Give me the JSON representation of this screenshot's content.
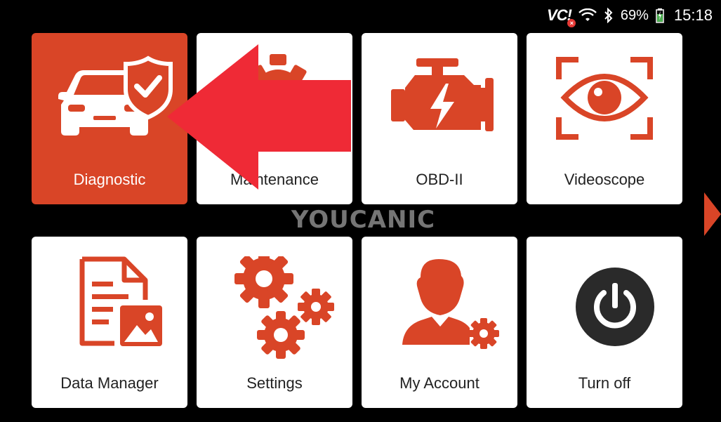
{
  "status": {
    "vci_label": "VC!",
    "battery_text": "69%",
    "time": "15:18"
  },
  "tiles": [
    {
      "label": "Diagnostic",
      "icon": "car-shield-icon"
    },
    {
      "label": "Maintenance",
      "icon": "gear-icon"
    },
    {
      "label": "OBD-II",
      "icon": "engine-icon"
    },
    {
      "label": "Videoscope",
      "icon": "eye-icon"
    },
    {
      "label": "Data Manager",
      "icon": "document-image-icon"
    },
    {
      "label": "Settings",
      "icon": "gears-icon"
    },
    {
      "label": "My Account",
      "icon": "user-gear-icon"
    },
    {
      "label": "Turn off",
      "icon": "power-icon"
    }
  ],
  "watermark": "YOUCANIC",
  "colors": {
    "accent": "#d94527",
    "arrow": "#ef2a36",
    "background": "#000000"
  }
}
